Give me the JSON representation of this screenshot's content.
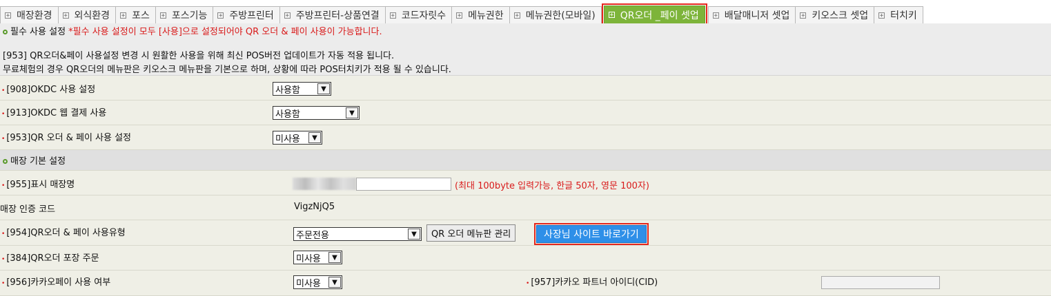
{
  "tabs": [
    {
      "label": "매장환경"
    },
    {
      "label": "외식환경"
    },
    {
      "label": "포스"
    },
    {
      "label": "포스기능"
    },
    {
      "label": "주방프린터"
    },
    {
      "label": "주방프린터-상품연결"
    },
    {
      "label": "코드자릿수"
    },
    {
      "label": "메뉴권한"
    },
    {
      "label": "메뉴권한(모바일)"
    },
    {
      "label": "QR오더 _페이 셋업",
      "active": true
    },
    {
      "label": "배달매니저 셋업"
    },
    {
      "label": "키오스크 셋업"
    },
    {
      "label": "터치키"
    }
  ],
  "notice": {
    "required_title": "필수 사용 설정",
    "required_warning": "*필수 사용 설정이 모두 [사용]으로 설정되어야 QR 오더 & 페이 사용이 가능합니다.",
    "line1": "[953] QR오더&페이 사용설정 변경 시 원활한 사용을 위해 최신 POS버전 업데이트가 자동 적용 됩니다.",
    "line2": "무료체험의 경우 QR오더의 메뉴판은 키오스크 메뉴판을 기본으로 하며, 상황에 따라 POS터치키가 적용 될 수 있습니다."
  },
  "rows": {
    "okdc": {
      "label": "[908]OKDC 사용 설정",
      "value": "사용함"
    },
    "okdc_web": {
      "label": "[913]OKDC 웹 결제 사용",
      "value": "사용함"
    },
    "qr_use": {
      "label": "[953]QR 오더 & 페이 사용 설정",
      "value": "미사용"
    },
    "section_basic": {
      "label": "매장 기본 설정"
    },
    "store_name": {
      "label": "[955]표시 매장명",
      "hint": "(최대 100byte 입력가능, 한글 50자, 영문 100자)"
    },
    "auth_code": {
      "label": "매장 인증 코드",
      "value": "VigzNjQ5"
    },
    "qr_type": {
      "label": "[954]QR오더 & 페이 사용유형",
      "value": "주문전용",
      "menu_button": "QR 오더 메뉴판 관리",
      "owner_button": "사장님 사이트 바로가기"
    },
    "takeout": {
      "label": "[384]QR오더 포장 주문",
      "value": "미사용"
    },
    "kakaopay": {
      "label": "[956]카카오페이 사용 여부",
      "value": "미사용",
      "partner_label": "[957]카카오 파트너 아이디(CID)"
    }
  },
  "colors": {
    "active_tab": "#7db43a",
    "highlight": "#e5261c",
    "required_text": "#d91a1a",
    "primary_button": "#2e8fe8"
  }
}
